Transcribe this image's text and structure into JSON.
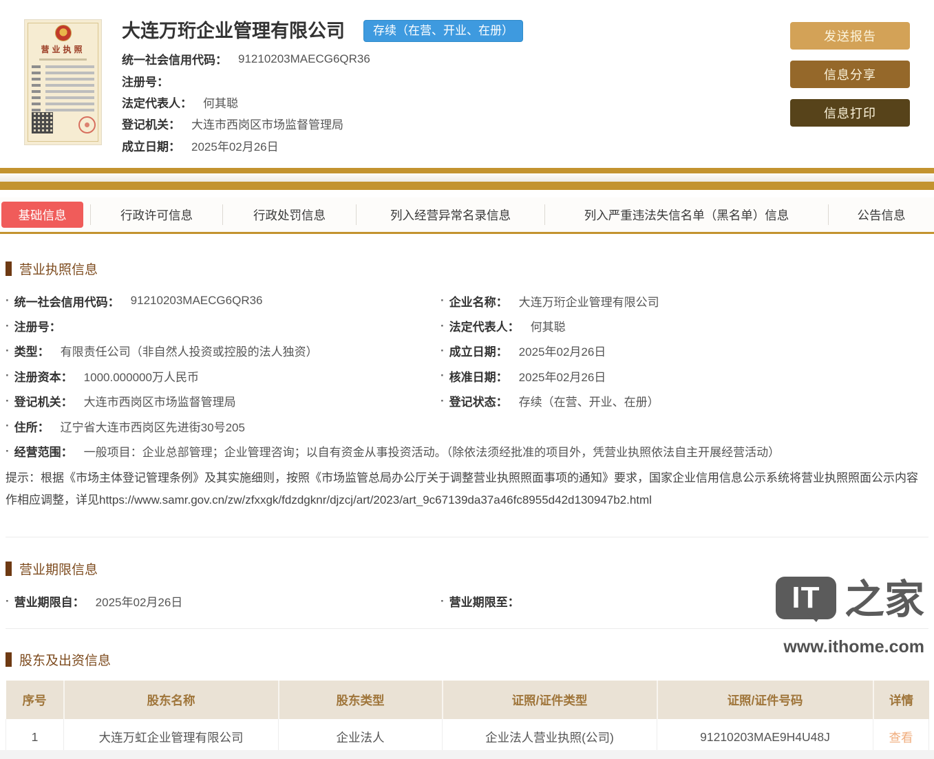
{
  "header": {
    "company_name": "大连万珩企业管理有限公司",
    "status_badge": "存续（在营、开业、在册）",
    "license_thumb": {
      "title": "营业执照"
    },
    "fields": [
      {
        "label": "统一社会信用代码：",
        "value": "91210203MAECG6QR36"
      },
      {
        "label": "注册号：",
        "value": ""
      },
      {
        "label": "法定代表人：",
        "value": "何其聪"
      },
      {
        "label": "登记机关：",
        "value": "大连市西岗区市场监督管理局"
      },
      {
        "label": "成立日期：",
        "value": "2025年02月26日"
      }
    ],
    "buttons": [
      {
        "label": "发送报告"
      },
      {
        "label": "信息分享"
      },
      {
        "label": "信息打印"
      }
    ]
  },
  "tabs": [
    {
      "label": "基础信息",
      "active": true
    },
    {
      "label": "行政许可信息",
      "active": false
    },
    {
      "label": "行政处罚信息",
      "active": false
    },
    {
      "label": "列入经营异常名录信息",
      "active": false
    },
    {
      "label": "列入严重违法失信名单（黑名单）信息",
      "active": false
    },
    {
      "label": "公告信息",
      "active": false
    }
  ],
  "business_license_section": {
    "title": "营业执照信息",
    "fields_left": [
      {
        "label": "统一社会信用代码：",
        "value": "91210203MAECG6QR36"
      },
      {
        "label": "注册号：",
        "value": ""
      },
      {
        "label": "类型：",
        "value": "有限责任公司（非自然人投资或控股的法人独资）"
      },
      {
        "label": "注册资本：",
        "value": "1000.000000万人民币"
      },
      {
        "label": "登记机关：",
        "value": "大连市西岗区市场监督管理局"
      },
      {
        "label": "住所：",
        "value": "辽宁省大连市西岗区先进街30号205"
      }
    ],
    "fields_right": [
      {
        "label": "企业名称：",
        "value": "大连万珩企业管理有限公司"
      },
      {
        "label": "法定代表人：",
        "value": "何其聪"
      },
      {
        "label": "成立日期：",
        "value": "2025年02月26日"
      },
      {
        "label": "核准日期：",
        "value": "2025年02月26日"
      },
      {
        "label": "登记状态：",
        "value": "存续（在营、开业、在册）"
      }
    ],
    "business_scope": {
      "label": "经营范围：",
      "value": "一般项目：企业总部管理；企业管理咨询；以自有资金从事投资活动。（除依法须经批准的项目外，凭营业执照依法自主开展经营活动）"
    },
    "notice": "提示：根据《市场主体登记管理条例》及其实施细则，按照《市场监管总局办公厅关于调整营业执照照面事项的通知》要求，国家企业信用信息公示系统将营业执照照面公示内容作相应调整，详见https://www.samr.gov.cn/zw/zfxxgk/fdzdgknr/djzcj/art/2023/art_9c67139da37a46fc8955d42d130947b2.html"
  },
  "business_term_section": {
    "title": "营业期限信息",
    "fields": [
      {
        "label": "营业期限自：",
        "value": "2025年02月26日"
      },
      {
        "label": "营业期限至：",
        "value": ""
      }
    ]
  },
  "shareholder_section": {
    "title": "股东及出资信息",
    "table": {
      "headers": [
        "序号",
        "股东名称",
        "股东类型",
        "证照/证件类型",
        "证照/证件号码",
        "详情"
      ],
      "row": {
        "index": "1",
        "shareholder_name": "大连万虹企业管理有限公司",
        "shareholder_type": "企业法人",
        "cert_type": "企业法人营业执照(公司)",
        "cert_number": "91210203MAE9H4U48J",
        "detail_link": "查看"
      }
    }
  },
  "watermark": {
    "logo": "IT",
    "logo_suffix": "之家",
    "url": "www.ithome.com"
  },
  "colors": {
    "gold": "#c3932f",
    "active_tab_red": "#f05c5a",
    "badge_blue": "#3e9adf",
    "section_title_brown": "#7d4b1e",
    "table_header_bg": "#eae2d5",
    "table_header_text": "#9f753a",
    "detail_link_orange": "#f0ad7d",
    "button_send": "#d3a257",
    "button_share": "#95682a",
    "button_print": "#57431a"
  }
}
